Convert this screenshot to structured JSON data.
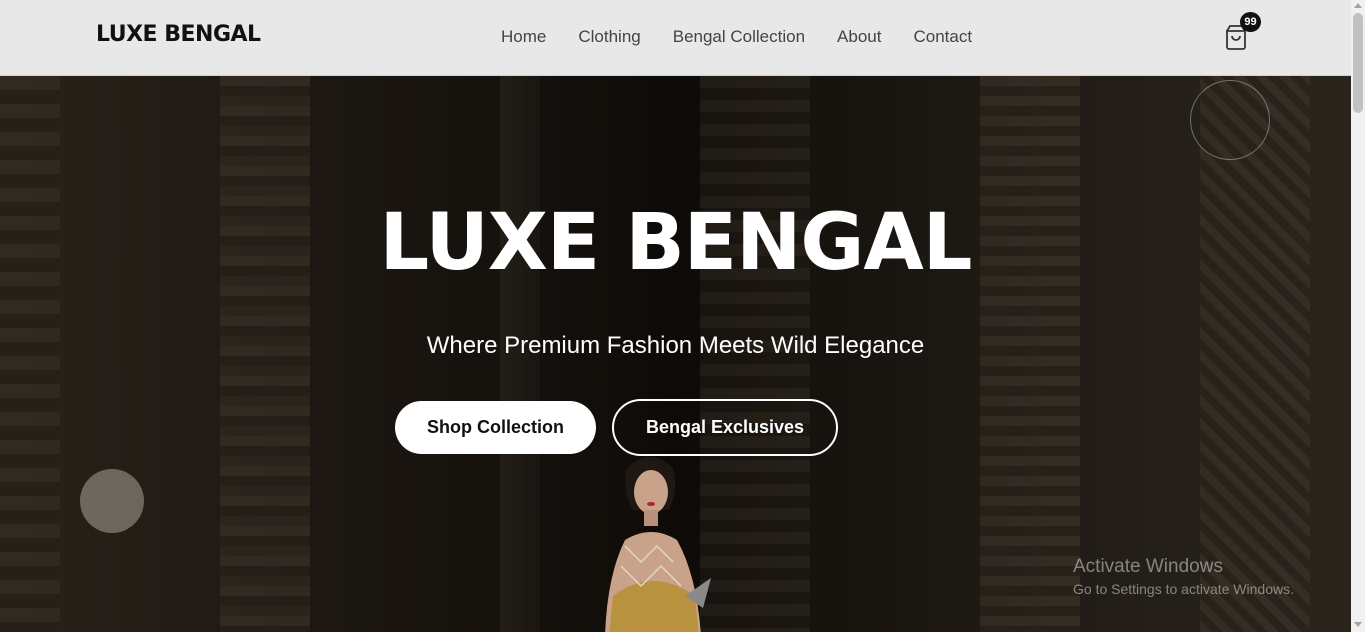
{
  "brand": {
    "logo": "LUXE BENGAL"
  },
  "nav": {
    "items": [
      {
        "label": "Home"
      },
      {
        "label": "Clothing"
      },
      {
        "label": "Bengal Collection"
      },
      {
        "label": "About"
      },
      {
        "label": "Contact"
      }
    ]
  },
  "cart": {
    "count": "99",
    "icon": "shopping-bag-icon"
  },
  "hero": {
    "title": "LUXE BENGAL",
    "subtitle": "Where Premium Fashion Meets Wild Elegance",
    "primary_cta": "Shop Collection",
    "secondary_cta": "Bengal Exclusives"
  },
  "os_watermark": {
    "line1": "Activate Windows",
    "line2": "Go to Settings to activate Windows."
  },
  "colors": {
    "header_bg": "#e8e8e8",
    "text_dark": "#111111",
    "hero_text": "#ffffff"
  }
}
